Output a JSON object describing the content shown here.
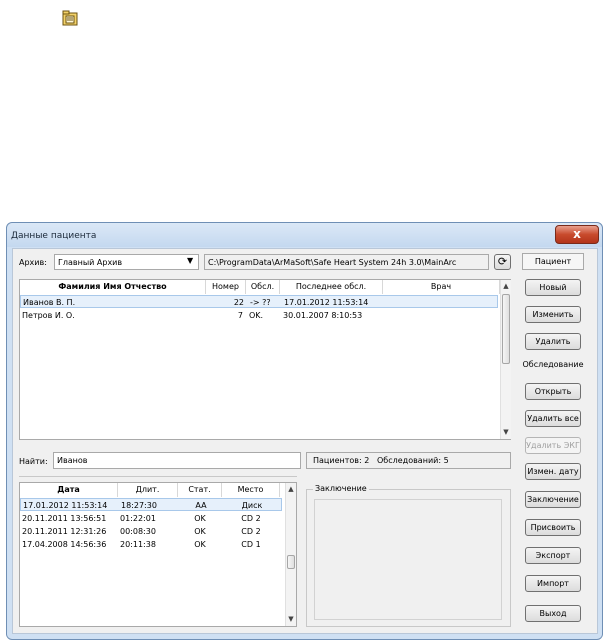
{
  "window": {
    "title": "Данные пациента",
    "close_glyph": "x"
  },
  "archive": {
    "label": "Архив:",
    "selected": "Главный Архив",
    "path": "C:\\ProgramData\\ArMaSoft\\Safe Heart System 24h 3.0\\MainArc"
  },
  "patients_table": {
    "columns": [
      "Фамилия Имя Отчество",
      "Номер",
      "Обсл.",
      "Последнее обсл.",
      "Врач"
    ],
    "rows": [
      {
        "name": "Иванов В. П.",
        "number": "22",
        "status": "-> ??",
        "last": "17.01.2012 11:53:14",
        "doctor": ""
      },
      {
        "name": "Петров И. О.",
        "number": "7",
        "status": "OK.",
        "last": "30.01.2007 8:10:53",
        "doctor": ""
      }
    ]
  },
  "search": {
    "label": "Найти:",
    "value": "Иванов"
  },
  "summary": {
    "patients": "Пациентов: 2",
    "exams": "Обследований: 5"
  },
  "exams_table": {
    "columns": [
      "Дата",
      "Длит.",
      "Стат.",
      "Место"
    ],
    "rows": [
      {
        "date": "17.01.2012 11:53:14",
        "duration": "18:27:30",
        "status": "AA",
        "place": "Диск"
      },
      {
        "date": "20.11.2011 13:56:51",
        "duration": "01:22:01",
        "status": "OK",
        "place": "CD 2"
      },
      {
        "date": "20.11.2011 12:31:26",
        "duration": "00:08:30",
        "status": "OK",
        "place": "CD 2"
      },
      {
        "date": "17.04.2008 14:56:36",
        "duration": "20:11:38",
        "status": "OK",
        "place": "CD 1"
      }
    ]
  },
  "conclusion": {
    "label": "Заключение"
  },
  "sidebar": {
    "patient_header": "Пациент",
    "new": "Новый",
    "edit": "Изменить",
    "delete": "Удалить",
    "exam_header": "Обследование",
    "open": "Открыть",
    "delete_all": "Удалить все",
    "delete_ecg": "Удалить ЭКГ",
    "change_date": "Измен. дату",
    "conclusion": "Заключение",
    "assign": "Присвоить",
    "export": "Экспорт",
    "import": "Импорт",
    "exit": "Выход"
  },
  "colors": {
    "selection": "#e6f0fb",
    "close": "#c84a2c",
    "frame": "#cfe0f3"
  }
}
